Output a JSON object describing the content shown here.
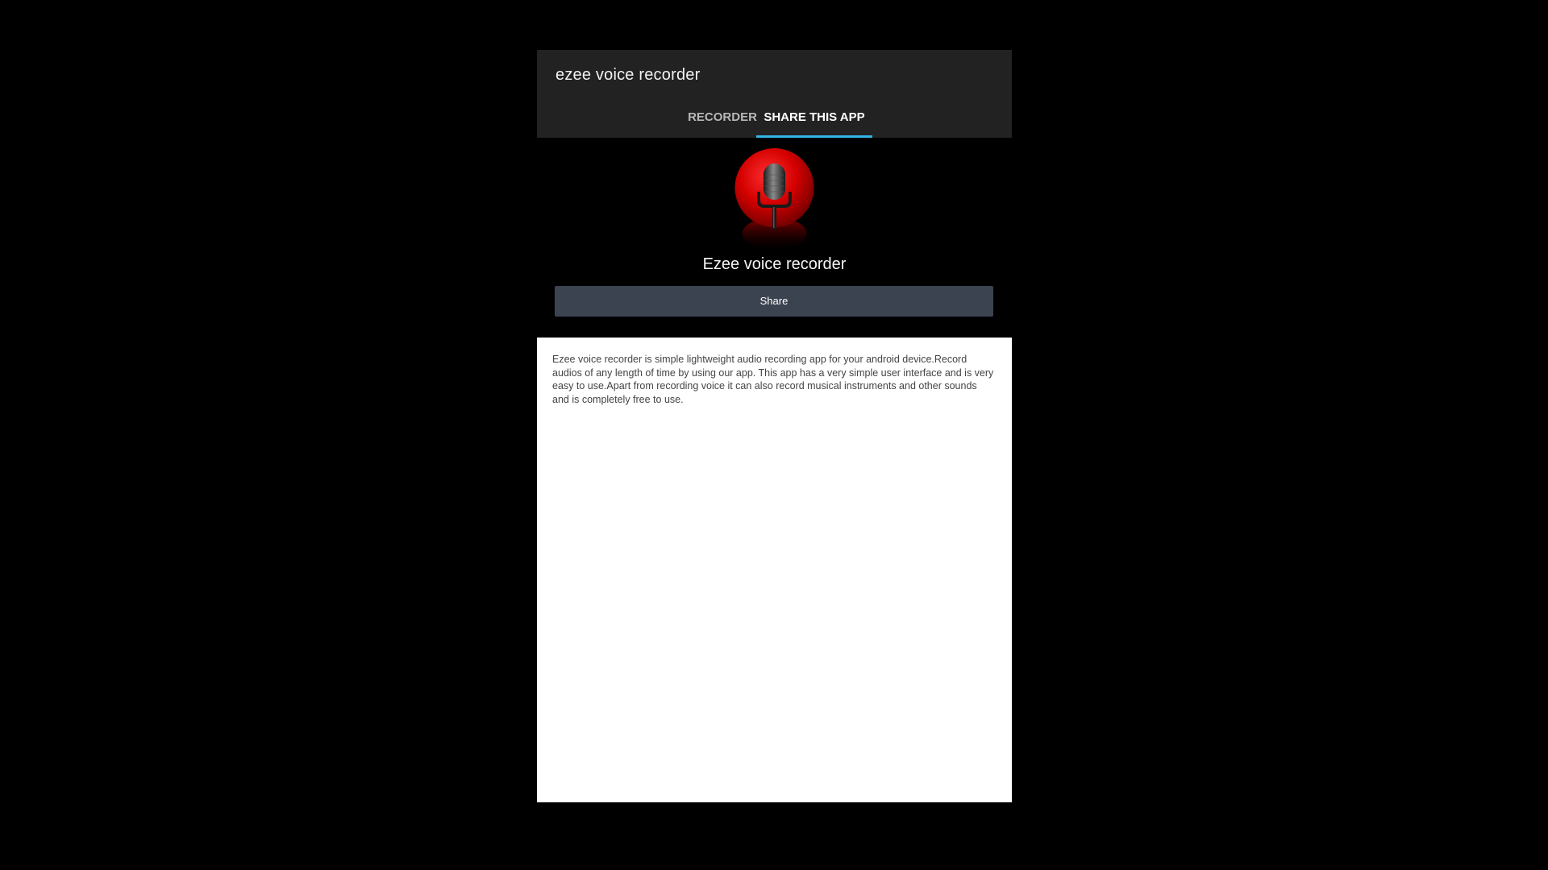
{
  "app": {
    "title": "ezee voice recorder"
  },
  "tabs": [
    {
      "label": "RECORDER",
      "selected": false
    },
    {
      "label": "SHARE THIS APP",
      "selected": true
    }
  ],
  "share_page": {
    "logo_icon": "red-microphone-icon",
    "app_name": "Ezee voice recorder",
    "share_button_label": "Share",
    "description": "Ezee voice recorder is simple lightweight audio recording app for your android device.Record audios of any length of time by using our app. This app has a very simple user interface and is very easy to use.Apart from recording voice it can also record musical instruments and other sounds and is completely free to use."
  },
  "colors": {
    "background": "#000000",
    "action_bar": "#222222",
    "tab_indicator": "#33b5e5",
    "share_button": "#3c4350",
    "description_panel": "#ffffff",
    "logo_red": "#d40000"
  }
}
